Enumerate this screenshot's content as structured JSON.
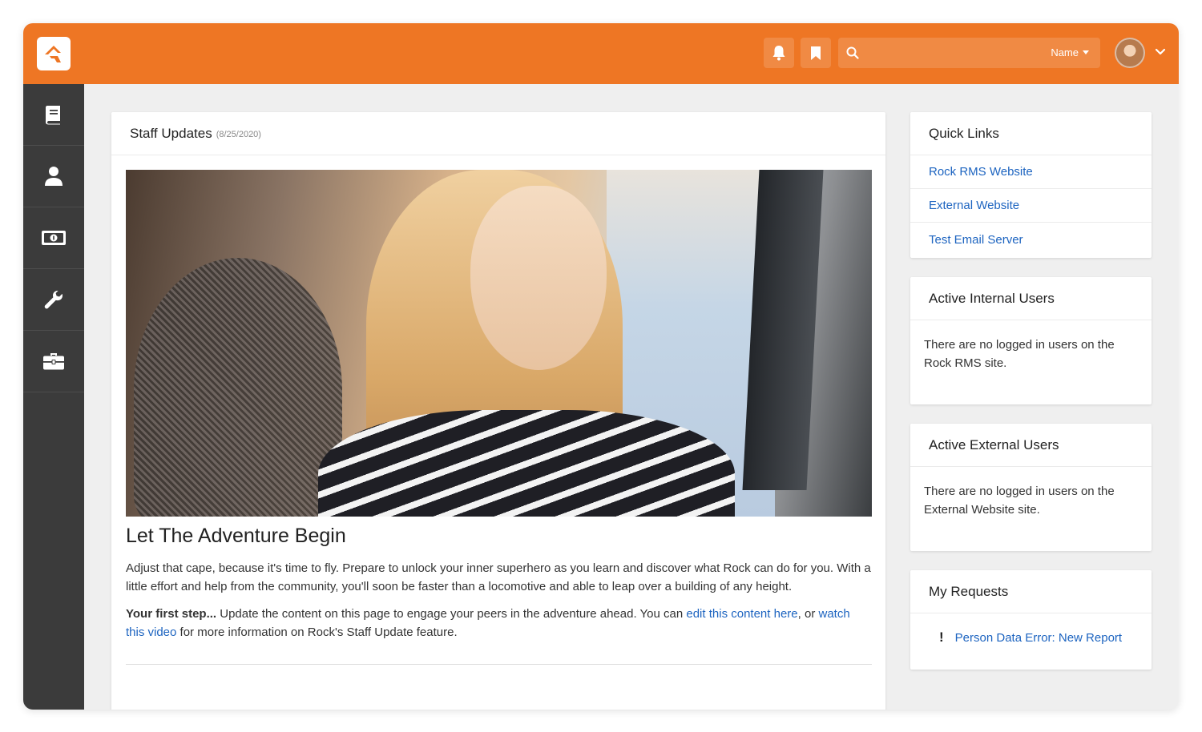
{
  "header": {
    "logo": "rock-rms-logo",
    "search": {
      "placeholder": "",
      "filter_label": "Name"
    }
  },
  "sidebar": {
    "items": [
      {
        "icon": "book-icon"
      },
      {
        "icon": "person-icon"
      },
      {
        "icon": "money-icon"
      },
      {
        "icon": "wrench-icon"
      },
      {
        "icon": "briefcase-icon"
      }
    ]
  },
  "main": {
    "title": "Staff Updates",
    "date": "(8/25/2020)",
    "article_title": "Let The Adventure Begin",
    "paragraph1": "Adjust that cape, because it's time to fly. Prepare to unlock your inner superhero as you learn and discover what Rock can do for you. With a little effort and help from the community, you'll soon be faster than a locomotive and able to leap over a building of any height.",
    "p2_bold": "Your first step...",
    "p2_text1": " Update the content on this page to engage your peers in the adventure ahead. You can ",
    "p2_link1": "edit this content here",
    "p2_text2": ", or ",
    "p2_link2": "watch this video",
    "p2_text3": " for more information on Rock's Staff Update feature."
  },
  "quick_links": {
    "title": "Quick Links",
    "items": [
      "Rock RMS Website",
      "External Website",
      "Test Email Server"
    ]
  },
  "internal_users": {
    "title": "Active Internal Users",
    "body": "There are no logged in users on the Rock RMS site."
  },
  "external_users": {
    "title": "Active External Users",
    "body": "There are no logged in users on the External Website site."
  },
  "requests": {
    "title": "My Requests",
    "items": [
      {
        "marker": "!",
        "label": "Person Data Error: New Report"
      }
    ]
  },
  "colors": {
    "brand": "#ee7624",
    "sidebar": "#3b3b3b",
    "link": "#1d64c0"
  }
}
